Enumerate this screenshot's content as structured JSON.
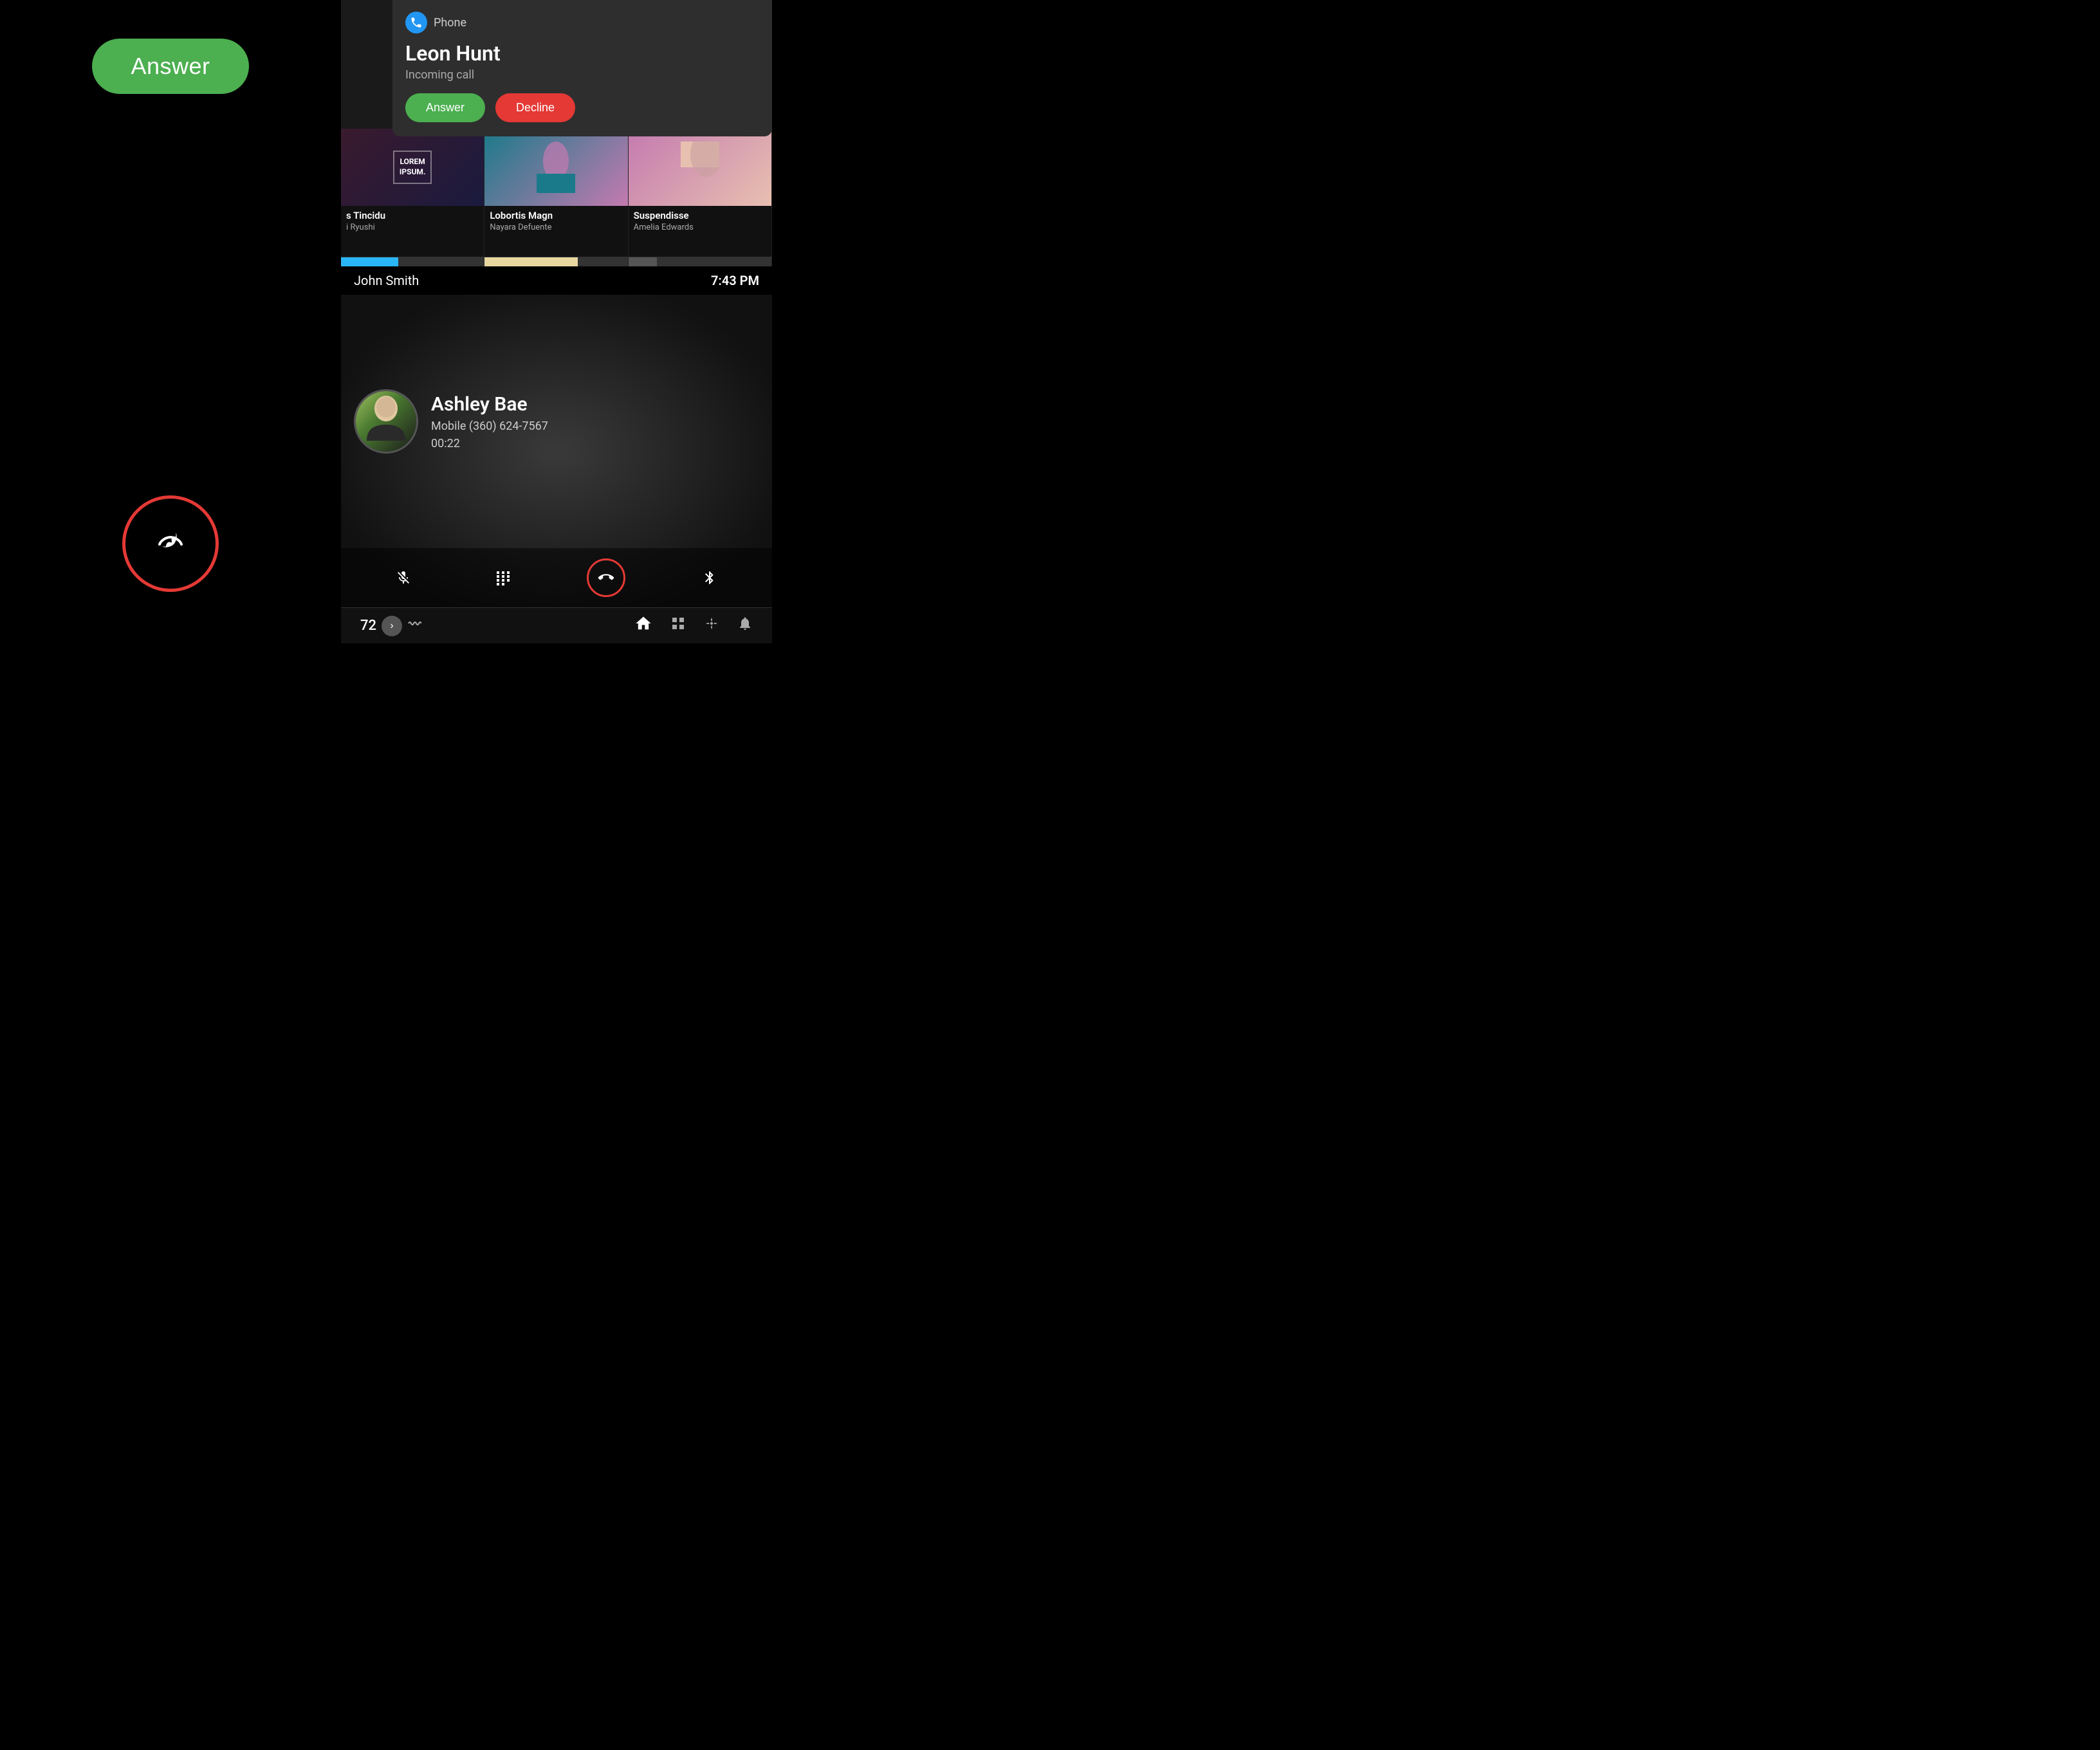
{
  "left": {
    "answer_button_label": "Answer",
    "end_call_icon": "☏"
  },
  "notification": {
    "app_label": "Phone",
    "caller_name": "Leon Hunt",
    "status": "Incoming call",
    "answer_label": "Answer",
    "decline_label": "Decline"
  },
  "cards": [
    {
      "title": "s Tincidu",
      "subtitle": "i Ryushi",
      "image_text": "LOREM\nIPSUM.",
      "progress_color": "fill-blue",
      "progress_pct": "40"
    },
    {
      "title": "Lobortis Magn",
      "subtitle": "Nayara Defuente",
      "progress_color": "fill-cream",
      "progress_pct": "65"
    },
    {
      "title": "Suspendisse",
      "subtitle": "Amelia Edwards",
      "progress_color": "fill-gray",
      "progress_pct": "20"
    }
  ],
  "caller_strip": {
    "name": "John Smith",
    "time": "7:43 PM"
  },
  "active_call": {
    "caller_name": "Ashley Bae",
    "caller_number": "Mobile (360) 624-7567",
    "duration": "00:22"
  },
  "controls": {
    "mute_icon": "🎤",
    "keypad_icon": "⠿",
    "end_call_icon": "☏",
    "bluetooth_icon": "⚡"
  },
  "bottom_nav": {
    "temperature": "72",
    "arrow_icon": "›",
    "wave_icon": "⌇",
    "home_icon": "⌂",
    "grid_icon": "⊞",
    "fan_icon": "✦",
    "bell_icon": "🔔"
  }
}
